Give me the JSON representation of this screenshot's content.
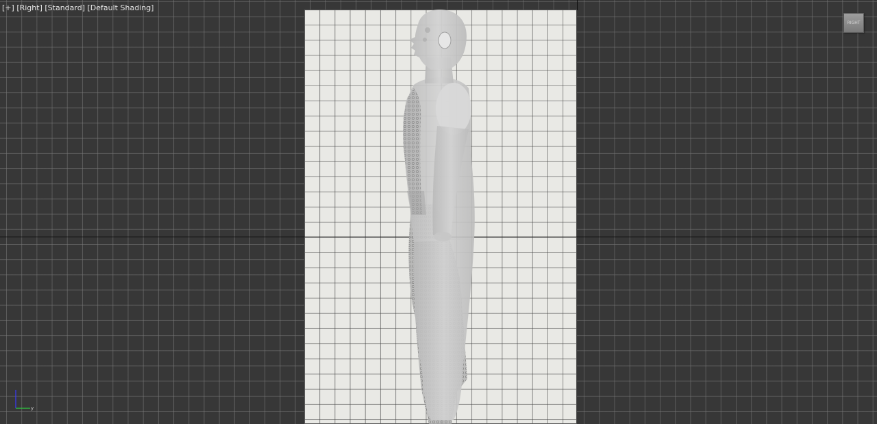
{
  "viewport": {
    "label_parts": [
      "[+]",
      "[Right]",
      "[Standard]",
      "[Default Shading]"
    ],
    "background_color": "#373737",
    "grid_color": "#787878",
    "reference_plane_color": "#e9e9e5"
  },
  "viewcube": {
    "label": "RIGHT"
  },
  "axis_tripod": {
    "y_axis_label": "y",
    "z_axis_color": "#3a3aff",
    "y_axis_color": "#2ecc40"
  },
  "scene": {
    "object": "human-figure-side-view",
    "shading": "semi-transparent grey"
  }
}
